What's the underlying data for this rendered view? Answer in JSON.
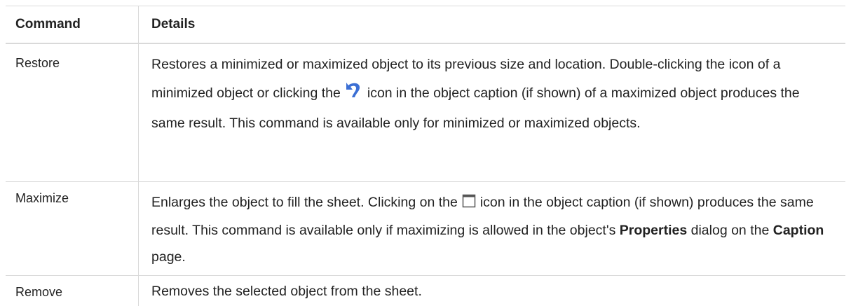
{
  "header": {
    "command": "Command",
    "details": "Details"
  },
  "rows": [
    {
      "command": "Restore",
      "details_before_icon": "Restores a minimized or maximized object to its previous size and location. Double-clicking the icon of a minimized object or clicking the",
      "icon": "restore-icon",
      "details_after_icon": "icon in the object caption (if shown) of a maximized object produces the same result. This command is available only for minimized or maximized objects."
    },
    {
      "command": "Maximize",
      "details_before_icon": "Enlarges the object to fill the sheet. Clicking on the",
      "icon": "maximize-icon",
      "details_after_icon": "icon in the object caption (if shown) produces the same result. This command is available only if maximizing is allowed in the object's",
      "bold_1": "Properties",
      "details_mid": "dialog on the",
      "bold_2": "Caption",
      "details_end": "page."
    },
    {
      "command": "Remove",
      "details": "Removes the selected object from the sheet."
    }
  ],
  "colors": {
    "border": "#d9d9d9",
    "text": "#222222",
    "icon_blue": "#3b6fd4"
  }
}
